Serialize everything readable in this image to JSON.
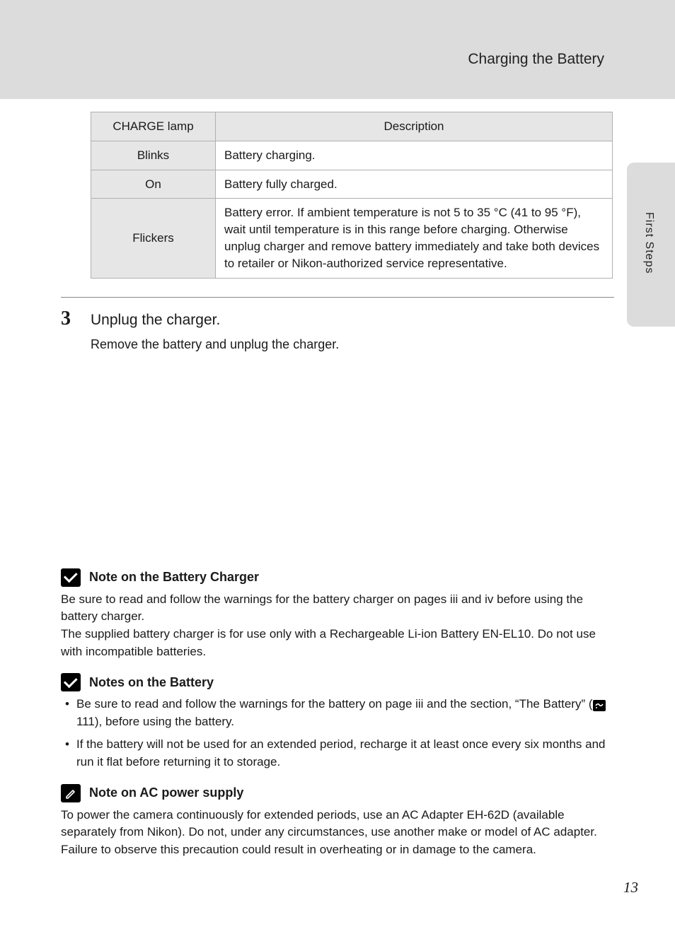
{
  "header": {
    "title": "Charging the Battery"
  },
  "side_tab": {
    "label": "First Steps"
  },
  "table": {
    "headers": [
      "CHARGE lamp",
      "Description"
    ],
    "rows": [
      {
        "state": "Blinks",
        "desc": "Battery charging."
      },
      {
        "state": "On",
        "desc": "Battery fully charged."
      },
      {
        "state": "Flickers",
        "desc": "Battery error. If ambient temperature is not 5 to 35 °C (41 to 95 °F), wait until temperature is in this range before charging. Otherwise unplug charger and remove battery immediately and take both devices to retailer or Nikon-authorized service representative."
      }
    ]
  },
  "step": {
    "number": "3",
    "title": "Unplug the charger.",
    "body": "Remove the battery and unplug the charger."
  },
  "notes": {
    "charger": {
      "title": "Note on the Battery Charger",
      "p1": "Be sure to read and follow the warnings for the battery charger on pages iii and iv before using the battery charger.",
      "p2": "The supplied battery charger is for use only with a Rechargeable Li-ion Battery EN-EL10. Do not use with incompatible batteries."
    },
    "battery": {
      "title": "Notes on the Battery",
      "item1_a": "Be sure to read and follow the warnings for the battery on page iii and the section, “The Battery” (",
      "item1_ref": " 111), before using the battery.",
      "item2": "If the battery will not be used for an extended period, recharge it at least once every six months and run it flat before returning it to storage."
    },
    "ac": {
      "title": "Note on AC power supply",
      "p1": "To power the camera continuously for extended periods, use an AC Adapter EH-62D (available separately from Nikon). Do not, under any circumstances, use another make or model of AC adapter. Failure to observe this precaution could result in overheating or in damage to the camera."
    }
  },
  "page_number": "13"
}
